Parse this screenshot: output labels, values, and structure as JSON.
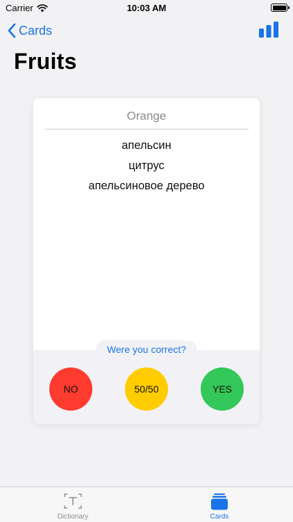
{
  "status_bar": {
    "carrier": "Carrier",
    "time": "10:03 AM"
  },
  "nav": {
    "back_label": "Cards",
    "title": "Fruits"
  },
  "card": {
    "word": "Orange",
    "translations": [
      "апельсин",
      "цитрус",
      "апельсиновое дерево"
    ],
    "question": "Were you correct?",
    "buttons": {
      "no": "NO",
      "half": "50/50",
      "yes": "YES"
    }
  },
  "tabs": [
    {
      "label": "Dictionary",
      "icon": "dictionary-icon",
      "active": false
    },
    {
      "label": "Cards",
      "icon": "cards-icon",
      "active": true
    }
  ],
  "colors": {
    "accent": "#1a73e8",
    "no": "#ff3b30",
    "half": "#ffcc00",
    "yes": "#34c759"
  }
}
